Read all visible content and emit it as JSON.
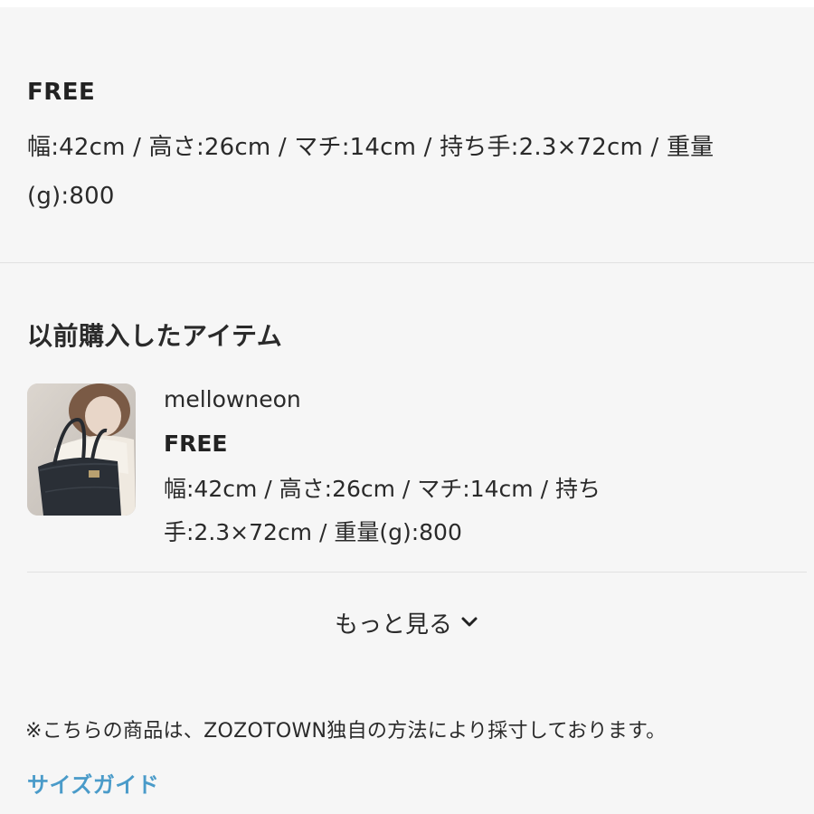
{
  "size_spec": {
    "label": "FREE",
    "detail": "幅:42cm / 高さ:26cm / マチ:14cm / 持ち手:2.3×72cm / 重量(g):800"
  },
  "previous_purchases": {
    "title": "以前購入したアイテム",
    "items": [
      {
        "brand": "mellowneon",
        "size": "FREE",
        "detail": "幅:42cm / 高さ:26cm / マチ:14cm / 持ち手:2.3×72cm / 重量(g):800",
        "thumbnail_icon": "tote-bag-photo"
      }
    ],
    "more_label": "もっと見る"
  },
  "footer": {
    "note": "※こちらの商品は、ZOZOTOWN独自の方法により採寸しております。",
    "guide_link": "サイズガイド"
  },
  "colors": {
    "background": "#f6f6f6",
    "text": "#222222",
    "link": "#4a9bc9",
    "divider": "#e1e1e1"
  }
}
